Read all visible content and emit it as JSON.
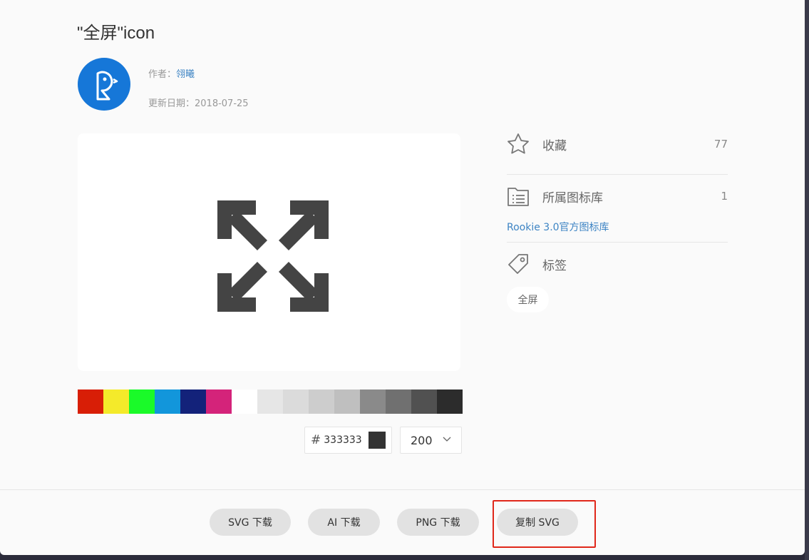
{
  "header": {
    "title": "\"全屏\"icon",
    "author_label": "作者：",
    "author_name": "翎曦",
    "date_label": "更新日期：",
    "date_value": "2018-07-25"
  },
  "avatar": {
    "icon": "rookie-bird-logo",
    "color": "#1677d8"
  },
  "preview": {
    "icon": "fullscreen-arrows-icon",
    "color": "#444444"
  },
  "palette": {
    "colors": [
      "#d81e06",
      "#f4ea2a",
      "#1afa29",
      "#1296db",
      "#13227a",
      "#d4237a",
      "#ffffff",
      "#e6e6e6",
      "#dbdbdb",
      "#cdcdcd",
      "#bfbfbf",
      "#8a8a8a",
      "#707070",
      "#515151",
      "#2c2c2c"
    ]
  },
  "color_input": {
    "hash": "#",
    "value": "333333",
    "chip_color": "#333333"
  },
  "size_select": {
    "value": "200"
  },
  "sidebar": {
    "favorites": {
      "label": "收藏",
      "count": "77",
      "icon": "star-icon"
    },
    "library": {
      "label": "所属图标库",
      "count": "1",
      "icon": "folder-list-icon",
      "link": "Rookie 3.0官方图标库"
    },
    "tags": {
      "label": "标签",
      "icon": "tag-icon",
      "items": [
        "全屏"
      ]
    }
  },
  "footer": {
    "buttons": [
      "SVG 下载",
      "AI 下载",
      "PNG 下载",
      "复制 SVG"
    ],
    "highlight_color": "#e0271a"
  }
}
